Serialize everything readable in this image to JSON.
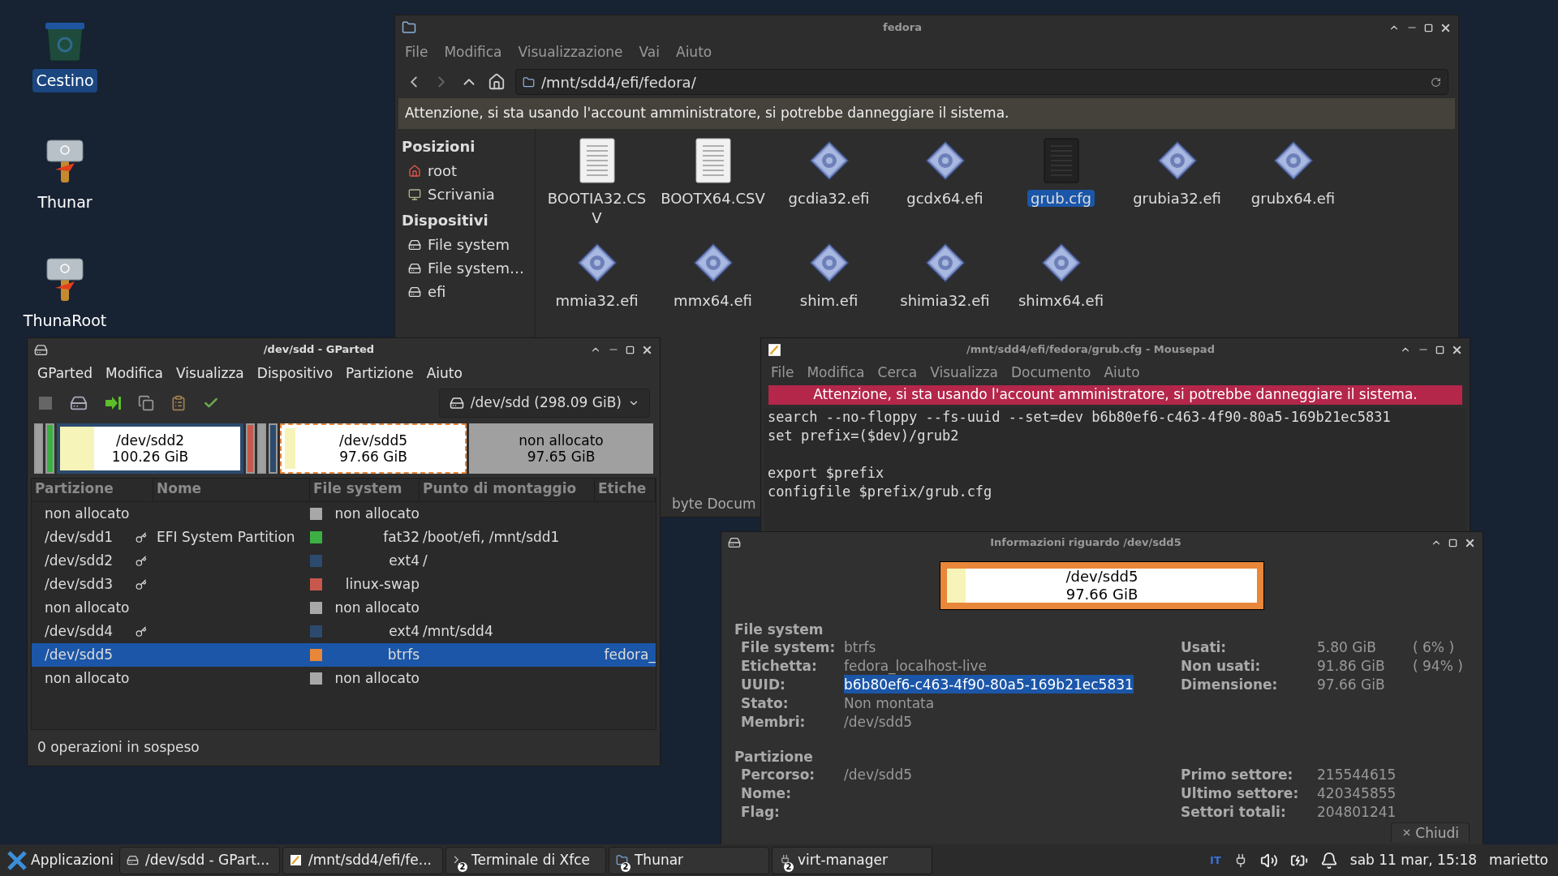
{
  "desktop_icons": [
    {
      "label": "Cestino",
      "kind": "trash",
      "selected": true
    },
    {
      "label": "Thunar",
      "kind": "hammer",
      "selected": false
    },
    {
      "label": "ThunaRoot",
      "kind": "hammer",
      "selected": false
    }
  ],
  "file_manager": {
    "title": "fedora",
    "menu": [
      "File",
      "Modifica",
      "Visualizzazione",
      "Vai",
      "Aiuto"
    ],
    "path": "/mnt/sdd4/efi/fedora/",
    "warning": "Attenzione, si sta usando l'account amministratore, si potrebbe danneggiare il sistema.",
    "sidebar": [
      {
        "heading": "Posizioni",
        "items": [
          {
            "label": "root",
            "kind": "home"
          },
          {
            "label": "Scrivania",
            "kind": "desktop"
          }
        ]
      },
      {
        "heading": "Dispositivi",
        "items": [
          {
            "label": "File system",
            "kind": "drive"
          },
          {
            "label": "File system…",
            "kind": "drive"
          },
          {
            "label": "efi",
            "kind": "drive"
          }
        ]
      }
    ],
    "files": [
      {
        "name": "BOOTIA32.CSV",
        "kind": "text",
        "selected": false
      },
      {
        "name": "BOOTX64.CSV",
        "kind": "text",
        "selected": false
      },
      {
        "name": "gcdia32.efi",
        "kind": "binary",
        "selected": false
      },
      {
        "name": "gcdx64.efi",
        "kind": "binary",
        "selected": false
      },
      {
        "name": "grub.cfg",
        "kind": "dark",
        "selected": true
      },
      {
        "name": "grubia32.efi",
        "kind": "binary",
        "selected": false
      },
      {
        "name": "grubx64.efi",
        "kind": "binary",
        "selected": false
      },
      {
        "name": "mmia32.efi",
        "kind": "binary",
        "selected": false
      },
      {
        "name": "mmx64.efi",
        "kind": "binary",
        "selected": false
      },
      {
        "name": "shim.efi",
        "kind": "binary",
        "selected": false
      },
      {
        "name": "shimia32.efi",
        "kind": "binary",
        "selected": false
      },
      {
        "name": "shimx64.efi",
        "kind": "binary",
        "selected": false
      }
    ],
    "status": "byte Docum"
  },
  "gparted": {
    "title": "/dev/sdd - GParted",
    "menu": [
      "GParted",
      "Modifica",
      "Visualizza",
      "Dispositivo",
      "Partizione",
      "Aiuto"
    ],
    "toolbar": [
      {
        "kind": "new"
      },
      {
        "kind": "delete"
      },
      {
        "kind": "resize"
      },
      {
        "kind": "copy"
      },
      {
        "kind": "paste"
      },
      {
        "kind": "apply"
      }
    ],
    "device": "/dev/sdd (298.09 GiB)",
    "map": [
      {
        "kind": "thin",
        "color": "#a0a0a0",
        "selected": false
      },
      {
        "kind": "thin",
        "color": "#3cb043",
        "selected": false
      },
      {
        "kind": "block",
        "color": "#2c4a6e",
        "label": "/dev/sdd2",
        "size": "100.26 GiB",
        "level": 0.19,
        "selected": false
      },
      {
        "kind": "thin",
        "color": "#c8584c",
        "selected": false
      },
      {
        "kind": "thin",
        "color": "#a0a0a0",
        "selected": false
      },
      {
        "kind": "thin",
        "color": "#2c4a6e",
        "selected": false
      },
      {
        "kind": "block",
        "color": "#e8873a",
        "label": "/dev/sdd5",
        "size": "97.66 GiB",
        "level": 0.06,
        "selected": true
      },
      {
        "kind": "free",
        "color": "#a0a0a0",
        "label": "non allocato",
        "size": "97.65 GiB",
        "selected": false
      }
    ],
    "columns": [
      "Partizione",
      "Nome",
      "File system",
      "Punto di montaggio",
      "Etiche"
    ],
    "rows": [
      {
        "partition": "non allocato",
        "mounted": false,
        "color": "#a8a8a8",
        "filesystem": "non allocato",
        "selected": false
      },
      {
        "partition": "/dev/sdd1",
        "mounted": true,
        "name": "EFI System Partition",
        "color": "#3cb043",
        "filesystem": "fat32",
        "mountpoint": "/boot/efi, /mnt/sdd1",
        "selected": false
      },
      {
        "partition": "/dev/sdd2",
        "mounted": true,
        "color": "#2c4a6e",
        "filesystem": "ext4",
        "mountpoint": "/",
        "selected": false
      },
      {
        "partition": "/dev/sdd3",
        "mounted": true,
        "color": "#c8584c",
        "filesystem": "linux-swap",
        "selected": false
      },
      {
        "partition": "non allocato",
        "mounted": false,
        "color": "#a8a8a8",
        "filesystem": "non allocato",
        "selected": false
      },
      {
        "partition": "/dev/sdd4",
        "mounted": true,
        "color": "#2c4a6e",
        "filesystem": "ext4",
        "mountpoint": "/mnt/sdd4",
        "selected": false
      },
      {
        "partition": "/dev/sdd5",
        "mounted": false,
        "color": "#e8873a",
        "filesystem": "btrfs",
        "label": "fedora_",
        "selected": true
      },
      {
        "partition": "non allocato",
        "mounted": false,
        "color": "#a8a8a8",
        "filesystem": "non allocato",
        "selected": false
      }
    ],
    "status": "0 operazioni in sospeso"
  },
  "editor": {
    "title": "/mnt/sdd4/efi/fedora/grub.cfg - Mousepad",
    "menu": [
      "File",
      "Modifica",
      "Cerca",
      "Visualizza",
      "Documento",
      "Aiuto"
    ],
    "warning": "Attenzione, si sta usando l'account amministratore, si potrebbe danneggiare il sistema.",
    "lines": [
      {
        "kind": "code",
        "text": "search --no-floppy --fs-uuid --set=dev b6b80ef6-c463-4f90-80a5-169b21ec5831"
      },
      {
        "kind": "code",
        "text": "set prefix=($dev)/grub2"
      },
      {
        "kind": "blank"
      },
      {
        "kind": "code",
        "text": "export $prefix"
      },
      {
        "kind": "code",
        "text": "configfile $prefix/grub.cfg"
      }
    ]
  },
  "info_dialog": {
    "title": "Informazioni riguardo /dev/sdd5",
    "bar": {
      "label": "/dev/sdd5",
      "size": "97.66 GiB",
      "level": 0.06
    },
    "sections": [
      {
        "heading": "File system",
        "left": [
          {
            "label": "File system:",
            "value": "btrfs",
            "selected": false
          },
          {
            "label": "Etichetta:",
            "value": "fedora_localhost-live",
            "selected": false
          },
          {
            "label": "UUID:",
            "value": "b6b80ef6-c463-4f90-80a5-169b21ec5831",
            "selected": true
          },
          {
            "label": "Stato:",
            "value": "Non montata",
            "selected": false
          },
          {
            "label": "Membri:",
            "value": "/dev/sdd5",
            "selected": false
          }
        ],
        "right": [
          {
            "label": "Usati:",
            "value": "5.80 GiB",
            "extra": "( 6% )"
          },
          {
            "label": "Non usati:",
            "value": "91.86 GiB",
            "extra": "( 94% )"
          },
          {
            "label": "Dimensione:",
            "value": "97.66 GiB"
          }
        ]
      },
      {
        "heading": "Partizione",
        "left": [
          {
            "label": "Percorso:",
            "value": "/dev/sdd5",
            "selected": false
          },
          {
            "label": "Nome:"
          },
          {
            "label": "Flag:"
          }
        ],
        "right": [
          {
            "label": "Primo settore:",
            "value": "215544615"
          },
          {
            "label": "Ultimo settore:",
            "value": "420345855"
          },
          {
            "label": "Settori totali:",
            "value": "204801241"
          }
        ]
      }
    ],
    "close": "Chiudi"
  },
  "taskbar": {
    "start": "Applicazioni",
    "tasks": [
      {
        "label": "/dev/sdd - GPart...",
        "kind": "gparted"
      },
      {
        "label": "/mnt/sdd4/efi/fe...",
        "kind": "editor"
      },
      {
        "label": "Terminale di Xfce",
        "kind": "terminal",
        "count": "2"
      },
      {
        "label": "Thunar",
        "kind": "folder",
        "count": "2"
      },
      {
        "label": "virt-manager",
        "kind": "vm",
        "count": "2"
      }
    ],
    "keyboard": "IT",
    "clock": "sab 11 mar, 15:18",
    "user": "marietto"
  }
}
